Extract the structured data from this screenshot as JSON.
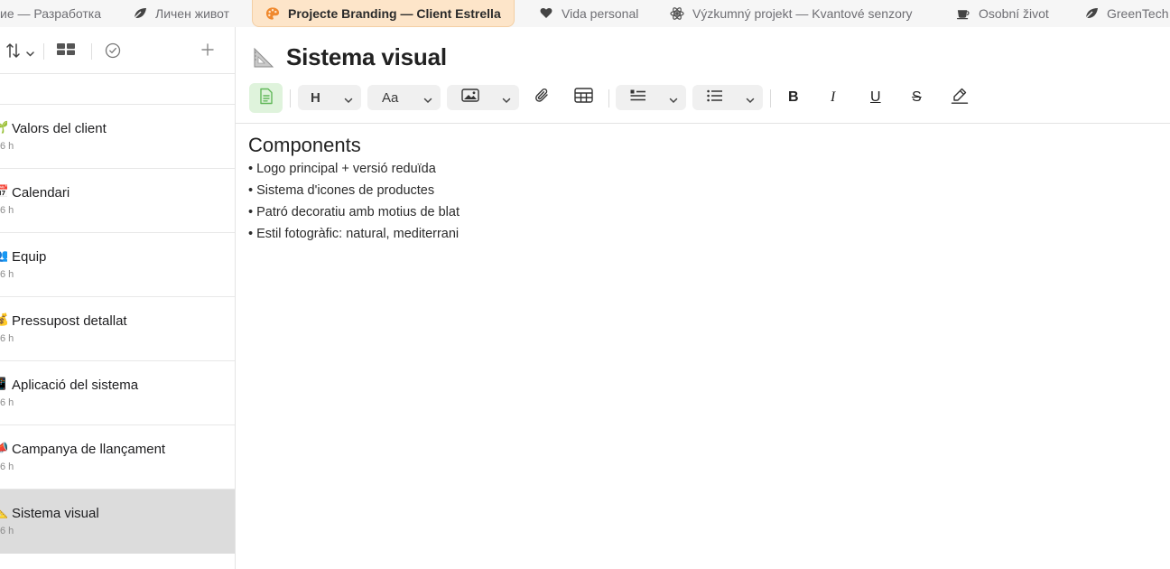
{
  "tabs": [
    {
      "icon": "code-icon",
      "label": "ие — Разработка",
      "active": false
    },
    {
      "icon": "leaf-icon",
      "label": "Личен живот",
      "active": false
    },
    {
      "icon": "palette-icon",
      "label": "Projecte Branding — Client Estrella",
      "active": true
    },
    {
      "icon": "heart-icon",
      "label": "Vida personal",
      "active": false
    },
    {
      "icon": "atom-icon",
      "label": "Výzkumný projekt — Kvantové senzory",
      "active": false
    },
    {
      "icon": "coffee-icon",
      "label": "Osobní život",
      "active": false
    },
    {
      "icon": "leaf-icon",
      "label": "GreenTech",
      "active": false
    }
  ],
  "sidebar": {
    "toolbar": {
      "sort_icon": "sort-icon",
      "view_icon": "gallery-view-icon",
      "done_icon": "checkmark-circle-icon",
      "add_icon": "plus-icon"
    },
    "notes": [
      {
        "emoji": "🌱",
        "title": "Valors del client",
        "meta": "6 h"
      },
      {
        "emoji": "📅",
        "title": "Calendari",
        "meta": "6 h"
      },
      {
        "emoji": "👥",
        "title": "Equip",
        "meta": "6 h"
      },
      {
        "emoji": "💰",
        "title": "Pressupost detallat",
        "meta": "6 h"
      },
      {
        "emoji": "📱",
        "title": "Aplicació del sistema",
        "meta": "6 h"
      },
      {
        "emoji": "📣",
        "title": "Campanya de llançament",
        "meta": "6 h"
      },
      {
        "emoji": "📐",
        "title": "Sistema visual",
        "meta": "6 h",
        "selected": true
      }
    ]
  },
  "editor": {
    "title_emoji": "📐",
    "title": "Sistema visual",
    "toolbar": {
      "heading_label": "H",
      "font_label": "Aa"
    },
    "content": {
      "heading": "Components",
      "lines": [
        "• Logo principal + versió reduïda",
        "• Sistema d'icones de productes",
        "• Patró decoratiu amb motius de blat",
        "• Estil fotogràfic: natural, mediterrani"
      ]
    }
  },
  "colors": {
    "active_tab_bg": "#fde5c9",
    "selected_note_bg": "#dcdcdc",
    "doc_button_bg": "#dff3dc",
    "accent_green": "#4caf50"
  }
}
